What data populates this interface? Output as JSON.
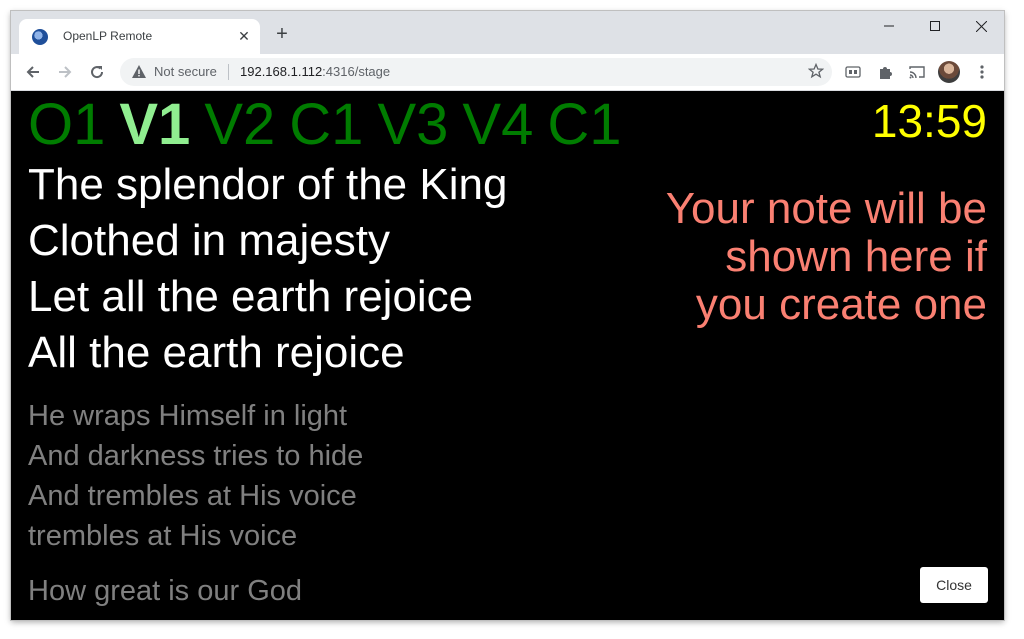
{
  "browser": {
    "tab_title": "OpenLP Remote",
    "new_tab": "+",
    "security": "Not secure",
    "url_host": "192.168.1.112",
    "url_rest": ":4316/stage"
  },
  "stage": {
    "tags": [
      "O1",
      "V1",
      "V2",
      "C1",
      "V3",
      "V4",
      "C1"
    ],
    "current_tag_index": 1,
    "clock": "13:59",
    "current_slide": [
      "The splendor of the King",
      "Clothed in majesty",
      "Let all the earth rejoice",
      "All the earth rejoice"
    ],
    "next_slide": [
      "He wraps Himself in light",
      "And darkness tries to hide",
      "And trembles at His voice",
      "trembles at His voice"
    ],
    "following_slide": "How great is our God",
    "note": "Your note will be shown here if you create one",
    "close_label": "Close"
  },
  "colors": {
    "tag": "#007c00",
    "tag_current": "#90ee90",
    "clock": "#ffff00",
    "note": "#fa8072",
    "next": "#808080"
  }
}
